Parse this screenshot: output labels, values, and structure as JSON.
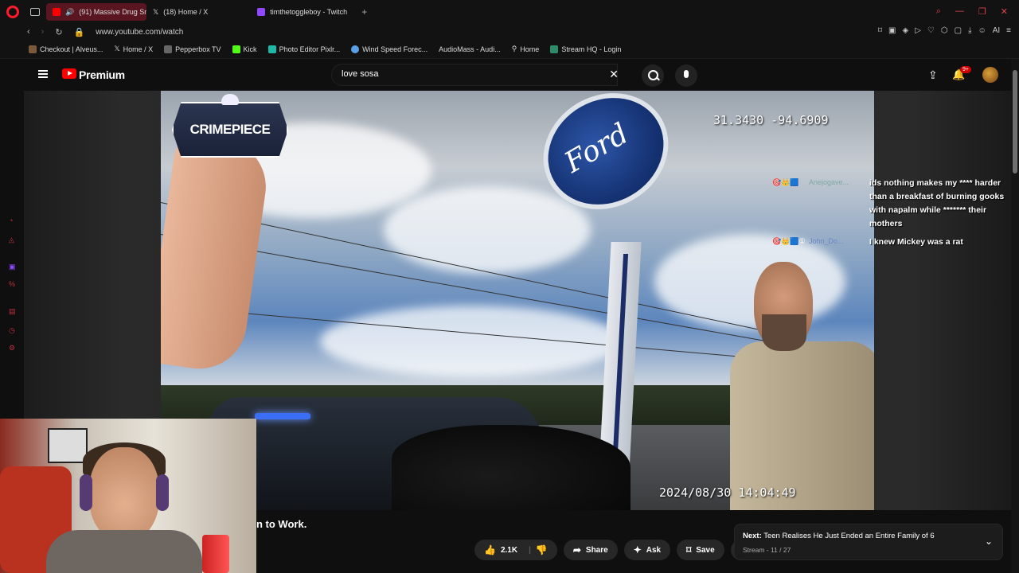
{
  "browser": {
    "tabs": [
      {
        "label": "(91) Massive Drug Smu",
        "active": true
      },
      {
        "label": "(18) Home / X",
        "active": false
      },
      {
        "label": "timthetoggleboy - Twitch",
        "active": false
      }
    ],
    "url": "www.youtube.com/watch",
    "bookmarks": [
      "Checkout | Alveus...",
      "Home / X",
      "Pepperbox TV",
      "Kick",
      "Photo Editor Pixlr...",
      "Wind Speed Forec...",
      "AudioMass - Audi...",
      "Home",
      "Stream HQ - Login"
    ],
    "ai_label": "AI"
  },
  "youtube": {
    "brand": "Premium",
    "search_value": "love sosa",
    "notification_count": "9+",
    "video_title": "n to Work.",
    "actions": {
      "like_count": "2.1K",
      "share": "Share",
      "ask": "Ask",
      "save": "Save"
    },
    "next": {
      "label": "Next:",
      "title": "Teen Realises He Just Ended an Entire Family of 6",
      "sub": "Stream - 11 / 27"
    }
  },
  "video": {
    "channel_logo": "CRIMEPIECE",
    "gps": "31.3430  -94.6909",
    "timestamp": "2024/08/30  14:04:49",
    "sign_text": "Ford"
  },
  "chat": [
    {
      "user": "Anejogave...",
      "message": "ids nothing makes my **** harder than a breakfast of burning gooks with napalm while ******* their mothers"
    },
    {
      "user": "John_Do...",
      "message": "I knew Mickey was a rat"
    }
  ],
  "colors": {
    "yt_red": "#ff0000",
    "opera_red": "#ff1b2d",
    "bg": "#0f0f0f"
  }
}
